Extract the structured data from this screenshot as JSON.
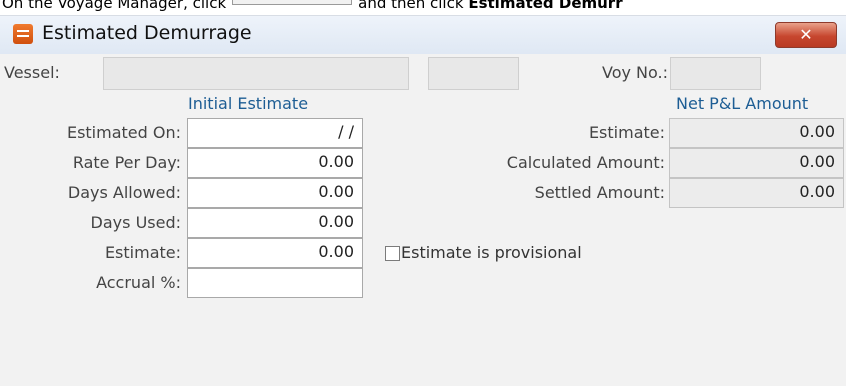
{
  "instruction": {
    "prefix": "On the Voyage Manager, click",
    "middle": "and then click",
    "bold": "Estimated Demurr"
  },
  "window": {
    "title": "Estimated Demurrage",
    "close_glyph": "✕"
  },
  "header": {
    "vessel_label": "Vessel:",
    "vessel_value": "",
    "voy_label": "Voy No.:",
    "voy_value": ""
  },
  "left": {
    "section_title": "Initial Estimate",
    "rows": [
      {
        "label": "Estimated On:",
        "value": "/ /"
      },
      {
        "label": "Rate Per Day:",
        "value": "0.00"
      },
      {
        "label": "Days Allowed:",
        "value": "0.00"
      },
      {
        "label": "Days Used:",
        "value": "0.00"
      },
      {
        "label": "Estimate:",
        "value": "0.00"
      },
      {
        "label": "Accrual %:",
        "value": ""
      }
    ]
  },
  "right": {
    "section_title": "Net P&L Amount",
    "rows": [
      {
        "label": "Estimate:",
        "value": "0.00"
      },
      {
        "label": "Calculated Amount:",
        "value": "0.00"
      },
      {
        "label": "Settled Amount:",
        "value": "0.00"
      }
    ]
  },
  "provisional": {
    "label": "Estimate is provisional",
    "checked": false
  },
  "colors": {
    "accent_text": "#1d5d94",
    "close_button": "#c7472f",
    "app_icon": "#e0601c"
  },
  "icons": {
    "app": "document-list-icon",
    "close": "close-icon",
    "checkbox": "checkbox-icon"
  }
}
